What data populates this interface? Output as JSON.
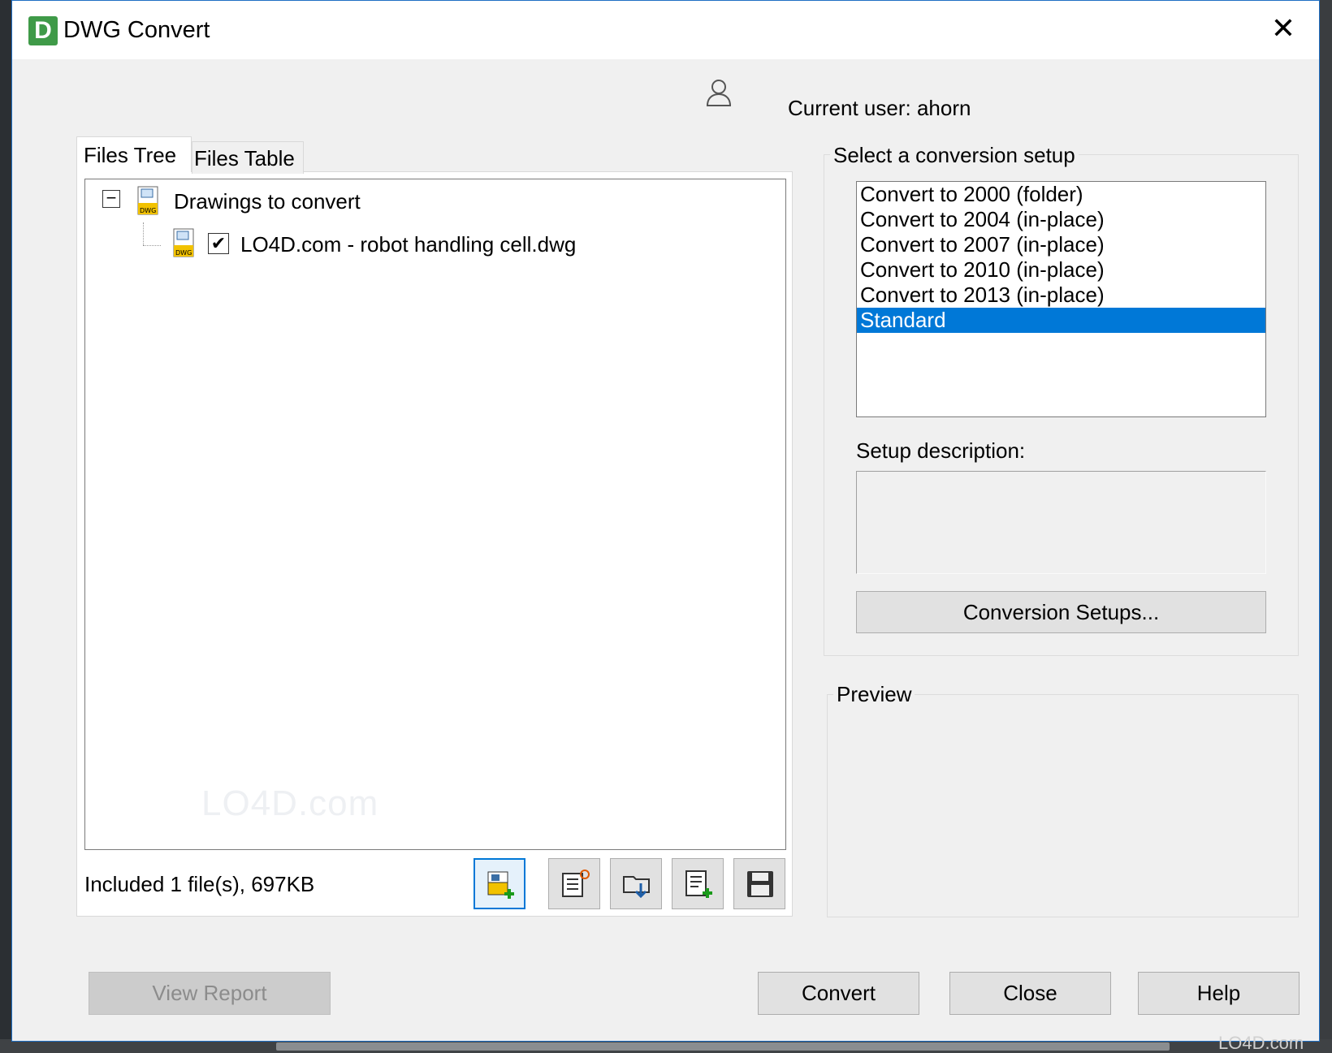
{
  "window": {
    "title": "DWG Convert",
    "close_symbol": "✕"
  },
  "user": {
    "label": "Current user: ahorn"
  },
  "tabs": [
    {
      "label": "Files Tree",
      "active": true
    },
    {
      "label": "Files Table",
      "active": false
    }
  ],
  "tree": {
    "expander_symbol": "−",
    "root": {
      "label": "Drawings to convert",
      "icon": "dwg-icon"
    },
    "children": [
      {
        "label": "LO4D.com - robot handling cell.dwg",
        "checked": true,
        "check_symbol": "✔",
        "icon": "dwg-icon"
      }
    ]
  },
  "status": {
    "included": "Included 1 file(s), 697KB"
  },
  "toolbar": [
    {
      "name": "add-files-button",
      "icon": "add-files-icon"
    },
    {
      "name": "new-list-button",
      "icon": "new-list-icon"
    },
    {
      "name": "open-list-button",
      "icon": "open-folder-icon"
    },
    {
      "name": "append-list-button",
      "icon": "append-list-icon"
    },
    {
      "name": "save-list-button",
      "icon": "save-icon"
    }
  ],
  "setup": {
    "legend": "Select a conversion setup",
    "items": [
      "Convert to 2000 (folder)",
      "Convert to 2004 (in-place)",
      "Convert to 2007 (in-place)",
      "Convert to 2010 (in-place)",
      "Convert to 2013 (in-place)",
      "Standard"
    ],
    "selected_index": 5,
    "description_label": "Setup description:",
    "description": "",
    "setups_button": "Conversion Setups..."
  },
  "preview": {
    "legend": "Preview"
  },
  "buttons": {
    "view_report": "View Report",
    "convert": "Convert",
    "close": "Close",
    "help": "Help"
  },
  "watermark": "LO4D.com",
  "colors": {
    "accent": "#0078d7",
    "window_bg": "#f0f0f0",
    "app_icon": "#3f9a48"
  }
}
